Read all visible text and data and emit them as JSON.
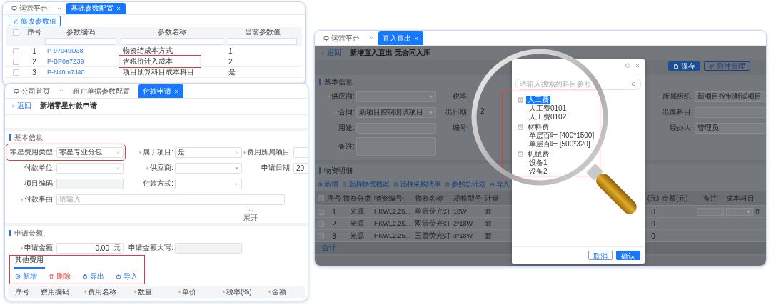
{
  "parameter_window": {
    "tabs": [
      {
        "label": "运营平台",
        "kind": "home",
        "selected": false
      },
      {
        "label": "基础参数配置",
        "kind": "page",
        "selected": true
      }
    ],
    "edit_button": "修改参数值",
    "columns": [
      "序号",
      "参数编码",
      "参数名称",
      "当前参数值"
    ],
    "rows": [
      {
        "index": "1",
        "code": "P-97949U38",
        "name": "物资结成本方式",
        "value": "1",
        "checked": false,
        "highlighted": false
      },
      {
        "index": "2",
        "code": "P-BP0a7Z39",
        "name": "含税价计入成本",
        "value": "2",
        "checked": false,
        "highlighted": true
      },
      {
        "index": "3",
        "code": "P-N40m7J40",
        "name": "项目预算科目成本科目",
        "value": "是",
        "checked": false,
        "highlighted": false
      }
    ],
    "all_checked": false
  },
  "payment_window": {
    "tabs": [
      {
        "label": "公司首页",
        "kind": "home",
        "selected": false
      },
      {
        "label": "租户单据参数配置",
        "kind": "page",
        "selected": false
      },
      {
        "label": "付款申请",
        "kind": "page",
        "selected": true
      }
    ],
    "back": "返回",
    "title": "新增零星付款申请",
    "basic_section": {
      "title": "基本信息",
      "fields": [
        {
          "label": "零星费用类型:",
          "required": true,
          "kind": "select",
          "value": "零星专业分包",
          "highlighted": true
        },
        {
          "label": "属于项目:",
          "required": true,
          "kind": "select",
          "value": "是",
          "highlighted": false
        },
        {
          "label": "费用所属项目:",
          "required": true,
          "kind": "select",
          "highlighted": false
        },
        {
          "label": "付款单位:",
          "required": false,
          "kind": "select",
          "highlighted": false
        },
        {
          "label": "供应商:",
          "required": true,
          "kind": "dropdown",
          "highlighted": false
        },
        {
          "label": "申请日期:",
          "required": false,
          "kind": "input",
          "value": "20",
          "highlighted": false
        },
        {
          "label": "项目编码:",
          "required": false,
          "kind": "disabled",
          "highlighted": false
        },
        {
          "label": "付款方式:",
          "required": false,
          "kind": "select",
          "highlighted": false
        },
        {
          "label": "付款事由:",
          "required": true,
          "kind": "wide",
          "placeholder": "请输入",
          "highlighted": false
        }
      ],
      "expand": "展开"
    },
    "amount_section": {
      "title": "申请金额",
      "fields": [
        {
          "label": "申请金额:",
          "required": true,
          "kind": "amount",
          "value": "0.00",
          "unit": "元"
        },
        {
          "label": "申请金额大写:",
          "required": false,
          "kind": "disabled"
        }
      ]
    },
    "detail_tabs": [
      {
        "label": "其他费用",
        "selected": true
      }
    ],
    "actions": [
      {
        "label": "新增",
        "kind": "add"
      },
      {
        "label": "删除",
        "kind": "delete"
      },
      {
        "label": "导出",
        "kind": "export"
      },
      {
        "label": "导入",
        "kind": "import"
      }
    ],
    "actions_highlighted": true,
    "columns": [
      {
        "label": "序号",
        "required": false
      },
      {
        "label": "费用编码",
        "required": false
      },
      {
        "label": "费用名称",
        "required": true
      },
      {
        "label": "数量",
        "required": true
      },
      {
        "label": "单价",
        "required": true
      },
      {
        "label": "税率(%)",
        "required": true
      },
      {
        "label": "金额",
        "required": true
      }
    ]
  },
  "entry_window": {
    "tabs": [
      {
        "label": "运营平台",
        "kind": "home",
        "selected": false
      },
      {
        "label": "直入直出",
        "kind": "page",
        "selected": true
      }
    ],
    "back": "返回",
    "title": "新增直入直出 无合同入库",
    "buttons": [
      {
        "label": "保存",
        "kind": "save",
        "primary": true
      },
      {
        "label": "附件管理",
        "kind": "attach",
        "primary": false
      }
    ],
    "basic_section": {
      "title": "基本信息",
      "left_fields": [
        {
          "label": "供应商:",
          "required": true,
          "kind": "dropdown"
        },
        {
          "label": "合同:",
          "required": true,
          "kind": "dropdown",
          "value": "新项目控制测试项目"
        },
        {
          "label": "用途:",
          "required": false,
          "kind": "input"
        },
        {
          "label": "备注:",
          "required": false,
          "kind": "textarea"
        }
      ],
      "middle_fields": [
        {
          "label": "税率:"
        },
        {
          "label": "出日期:",
          "value": "2"
        },
        {
          "label": "编号:"
        }
      ],
      "right_fields": [
        {
          "label": "所属组织:",
          "required": true,
          "value": "新项目控制测试项目"
        },
        {
          "label": "出库科目:",
          "required": false
        },
        {
          "label": "经办人:",
          "required": false,
          "value": "管理员"
        }
      ]
    },
    "detail_section": {
      "title": "物资明细",
      "actions": [
        {
          "label": "新增",
          "kind": "add"
        },
        {
          "label": "选择物资档案",
          "kind": "doc"
        },
        {
          "label": "选择采购清单",
          "kind": "doc"
        },
        {
          "label": "参照总计划",
          "kind": "doc"
        },
        {
          "label": "导入",
          "kind": "import"
        }
      ],
      "left_columns": [
        "序号",
        "物资分类",
        "物资编号",
        "物资名称",
        "规格型号",
        "计量"
      ],
      "right_columns": [
        "(元)",
        "金额(元)",
        "备注",
        "成本科目"
      ],
      "rows": [
        {
          "index": "1",
          "category": "光源",
          "code": "HKWL2.25...",
          "name": "单管荧光灯",
          "spec": "18W",
          "unit": "套",
          "price": "0",
          "checked": false,
          "editable": true
        },
        {
          "index": "2",
          "category": "光源",
          "code": "HKWL2.25...",
          "name": "双管荧光灯",
          "spec": "2*18W",
          "unit": "套",
          "price": "0",
          "checked": false,
          "editable": false
        },
        {
          "index": "3",
          "category": "光源",
          "code": "HKWL2.25...",
          "name": "三管荧光灯",
          "spec": "3*18W",
          "unit": "套",
          "price": "0",
          "checked": false,
          "editable": false
        }
      ],
      "all_checked": false,
      "total_label": "合计"
    },
    "dialog": {
      "search_placeholder": "请输入搜索的科目参照",
      "tree": [
        {
          "label": "人工费",
          "selected": true,
          "expanded": true,
          "children": [
            {
              "label": "人工费0101",
              "selected": false
            },
            {
              "label": "人工费0102",
              "selected": false
            }
          ]
        },
        {
          "label": "材料费",
          "selected": false,
          "expanded": true,
          "children": [
            {
              "label": "单层百叶 [400*1500]",
              "selected": false
            },
            {
              "label": "单层百叶 [500*320]",
              "selected": false
            }
          ]
        },
        {
          "label": "机械费",
          "selected": false,
          "expanded": true,
          "children": [
            {
              "label": "设备1",
              "selected": false
            },
            {
              "label": "设备2",
              "selected": false
            }
          ]
        }
      ],
      "tree_highlighted": true,
      "buttons": [
        {
          "label": "取消",
          "primary": false
        },
        {
          "label": "确认",
          "primary": true
        }
      ]
    }
  }
}
